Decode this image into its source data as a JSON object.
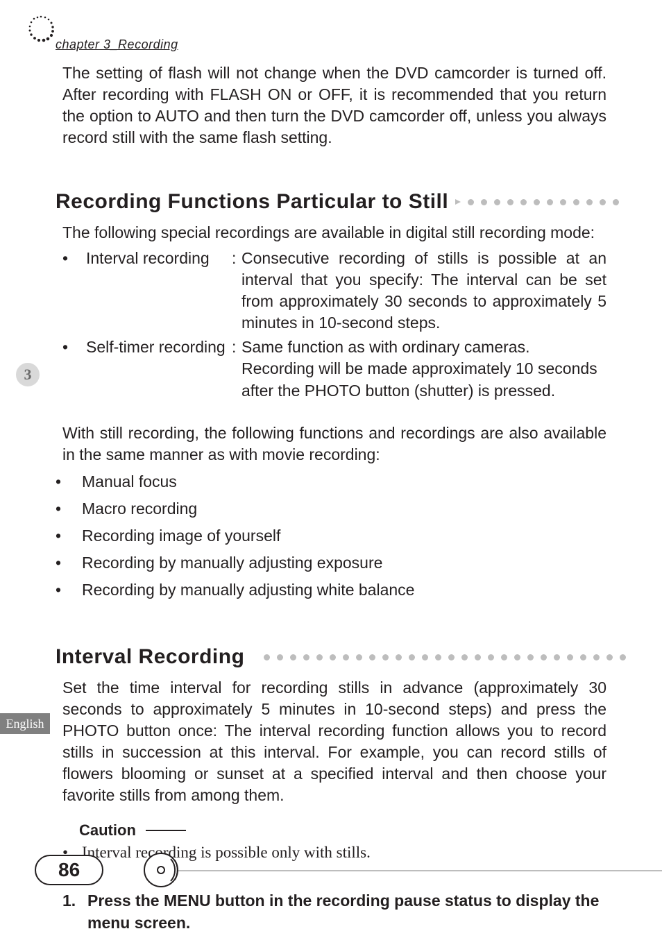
{
  "header": {
    "chapter_label": "chapter 3_Recording"
  },
  "intro_paragraph": "The setting of flash will not change when the DVD camcorder is turned off. After recording with FLASH ON or OFF, it is recommended that you return the option to AUTO and then turn the DVD camcorder off, unless you always record still with the same flash setting.",
  "sections": {
    "functions": {
      "title": "Recording Functions Particular to Still",
      "lead": "The following special recordings are available in digital still recording mode:",
      "items": [
        {
          "term": "Interval recording",
          "desc": "Consecutive recording of stills is possible at an interval that you specify: The interval can be set from approximately 30 seconds to approximately 5 minutes in 10-second steps."
        },
        {
          "term": "Self-timer recording",
          "desc": "Same function as with ordinary cameras. Recording will be made approximately 10 seconds after the PHOTO button (shutter) is pressed."
        }
      ],
      "also_lead": "With still recording, the following functions and recordings are also available in the same manner as with movie recording:",
      "also_items": [
        "Manual focus",
        "Macro recording",
        "Recording image of yourself",
        "Recording by manually adjusting exposure",
        "Recording by manually adjusting white balance"
      ]
    },
    "interval": {
      "title": "Interval Recording",
      "body": "Set the time interval for recording stills in advance (approximately 30 seconds to approximately 5 minutes in 10-second steps) and press the PHOTO button once: The interval recording function allows you to record stills in succession at this interval. For example, you can record stills of flowers blooming or sunset at a specified interval and then choose your favorite stills from among them.",
      "caution_label": "Caution",
      "caution_items": [
        "Interval recording is possible only with stills."
      ],
      "steps": [
        {
          "num": "1.",
          "text": "Press the MENU button in the recording pause status to display the menu screen."
        }
      ]
    }
  },
  "side": {
    "language_tab": "English",
    "chapter_number": "3"
  },
  "footer": {
    "page_number": "86"
  }
}
